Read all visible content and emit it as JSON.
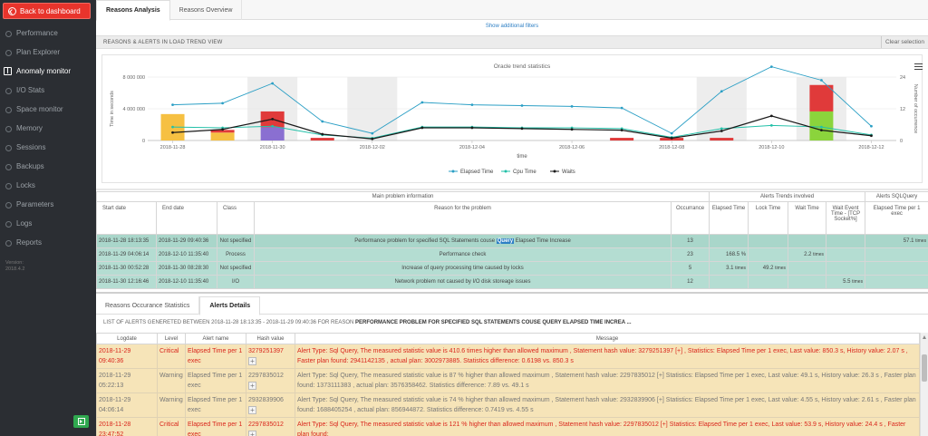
{
  "sidebar": {
    "back_label": "Back to dashboard",
    "items": [
      {
        "label": "Performance",
        "icon": "circle-icon",
        "active": false
      },
      {
        "label": "Plan Explorer",
        "icon": "circle-icon",
        "active": false
      },
      {
        "label": "Anomaly monitor",
        "icon": "book-icon",
        "active": true
      },
      {
        "label": "I/O Stats",
        "icon": "circle-icon",
        "active": false
      },
      {
        "label": "Space monitor",
        "icon": "circle-icon",
        "active": false
      },
      {
        "label": "Memory",
        "icon": "circle-icon",
        "active": false
      },
      {
        "label": "Sessions",
        "icon": "circle-icon",
        "active": false
      },
      {
        "label": "Backups",
        "icon": "circle-icon",
        "active": false
      },
      {
        "label": "Locks",
        "icon": "circle-icon",
        "active": false
      },
      {
        "label": "Parameters",
        "icon": "circle-icon",
        "active": false
      },
      {
        "label": "Logs",
        "icon": "circle-icon",
        "active": false
      },
      {
        "label": "Reports",
        "icon": "circle-icon",
        "active": false
      }
    ],
    "version_label": "Version:",
    "version_value": "2018.4.2"
  },
  "top_tabs": [
    {
      "label": "Reasons Analysis",
      "active": true
    },
    {
      "label": "Reasons Overview",
      "active": false
    }
  ],
  "additional_filters": "Show additional filters",
  "section": {
    "title": "REASONS & ALERTS IN LOAD TREND VIEW",
    "clear_label": "Clear selection"
  },
  "chart_data": {
    "type": "line",
    "title": "Oracle trend statistics",
    "xlabel": "time",
    "ylabel_left": "Time in seconds",
    "ylabel_right": "Number of occurrence",
    "y_ticks_left": [
      "0",
      "4 000 000",
      "8 000 000"
    ],
    "y_ticks_right": [
      "0",
      "12",
      "24"
    ],
    "ylim_left": [
      0,
      8000000
    ],
    "ylim_right": [
      0,
      24
    ],
    "x_ticks": [
      "2018-11-28",
      "2018-11-30",
      "2018-12-02",
      "2018-12-04",
      "2018-12-06",
      "2018-12-08",
      "2018-12-10",
      "2018-12-12"
    ],
    "x": [
      "2018-11-28",
      "2018-11-29",
      "2018-11-30",
      "2018-12-01",
      "2018-12-02",
      "2018-12-03",
      "2018-12-04",
      "2018-12-05",
      "2018-12-06",
      "2018-12-07",
      "2018-12-08",
      "2018-12-09",
      "2018-12-10",
      "2018-12-11",
      "2018-12-12"
    ],
    "series": [
      {
        "name": "Elapsed Time",
        "color": "#2b9fc5",
        "axis": "left",
        "values": [
          4500000,
          4700000,
          7200000,
          2400000,
          900000,
          4800000,
          4500000,
          4400000,
          4300000,
          4100000,
          900000,
          6200000,
          9300000,
          7600000,
          1800000
        ]
      },
      {
        "name": "Cpu Time",
        "color": "#22c0a8",
        "axis": "left",
        "values": [
          1700000,
          1600000,
          1800000,
          700000,
          300000,
          1700000,
          1700000,
          1600000,
          1600000,
          1500000,
          400000,
          1500000,
          1900000,
          1700000,
          700000
        ]
      },
      {
        "name": "Waits",
        "color": "#1a1a1a",
        "axis": "left",
        "values": [
          1000000,
          1400000,
          2700000,
          800000,
          200000,
          1600000,
          1600000,
          1500000,
          1400000,
          1300000,
          300000,
          1200000,
          3100000,
          1300000,
          600000
        ]
      }
    ],
    "stacked_bars": [
      {
        "x": "2018-11-28",
        "segments": [
          {
            "color": "#f6c042",
            "count": 10
          }
        ]
      },
      {
        "x": "2018-11-29",
        "segments": [
          {
            "color": "#f6c042",
            "count": 3
          },
          {
            "color": "#e03a3a",
            "count": 1
          }
        ]
      },
      {
        "x": "2018-11-30",
        "segments": [
          {
            "color": "#8a6fd1",
            "count": 5
          },
          {
            "color": "#e03a3a",
            "count": 6
          }
        ]
      },
      {
        "x": "2018-12-01",
        "segments": [
          {
            "color": "#e03a3a",
            "count": 1
          }
        ]
      },
      {
        "x": "2018-12-07",
        "segments": [
          {
            "color": "#e03a3a",
            "count": 1
          }
        ]
      },
      {
        "x": "2018-12-08",
        "segments": [
          {
            "color": "#e03a3a",
            "count": 1
          }
        ]
      },
      {
        "x": "2018-12-09",
        "segments": [
          {
            "color": "#e03a3a",
            "count": 1
          }
        ]
      },
      {
        "x": "2018-12-11",
        "segments": [
          {
            "color": "#8bd43c",
            "count": 11
          },
          {
            "color": "#e03a3a",
            "count": 10
          }
        ]
      }
    ],
    "highlight_ranges": [
      [
        "2018-11-30",
        "2018-12-01"
      ],
      [
        "2018-12-02",
        "2018-12-03"
      ],
      [
        "2018-12-09",
        "2018-12-10"
      ],
      [
        "2018-12-11",
        "2018-12-12"
      ]
    ],
    "legend_position": "bottom"
  },
  "reasons_table": {
    "group_headers": {
      "main": "Main problem information",
      "trends": "Alerts Trends involved",
      "sql": "Alerts SQLQuery"
    },
    "columns": [
      "Start date",
      "End date",
      "Class",
      "Reason for the problem",
      "Occurrance",
      "Elapsed Time",
      "Lock Time",
      "Wait Time",
      "Wait Event Time - [TCP Socket%]",
      "Elapsed Time per 1 exec"
    ],
    "rows": [
      {
        "start": "2018-11-28 18:13:35",
        "end": "2018-11-29 09:40:36",
        "class": "Not specified",
        "reason_pre": "Performance problem for specified SQL Statements couse",
        "reason_hl": "Query",
        "reason_post": "Elapsed Time Increase",
        "occ": "13",
        "elapsed": "",
        "lock": "",
        "wait": "",
        "waitev": "",
        "per1": "57.1",
        "per1_unit": "times"
      },
      {
        "start": "2018-11-29 04:06:14",
        "end": "2018-12-10 11:35:40",
        "class": "Process",
        "reason_pre": "Performance check",
        "reason_hl": "",
        "reason_post": "",
        "occ": "23",
        "elapsed": "168.5 %",
        "lock": "",
        "wait": "2.2",
        "wait_unit": "times",
        "waitev": "",
        "per1": ""
      },
      {
        "start": "2018-11-30 00:52:28",
        "end": "2018-11-30 08:28:30",
        "class": "Not specified",
        "reason_pre": "Increase of query processing time caused by locks",
        "reason_hl": "",
        "reason_post": "",
        "occ": "5",
        "elapsed": "3.1",
        "elapsed_unit": "times",
        "lock": "49.2",
        "lock_unit": "times",
        "wait": "",
        "waitev": "",
        "per1": ""
      },
      {
        "start": "2018-11-30 12:16:46",
        "end": "2018-12-10 11:35:40",
        "class": "I/O",
        "reason_pre": "Network problem not caused by I/O disk storeage issues",
        "reason_hl": "",
        "reason_post": "",
        "occ": "12",
        "elapsed": "",
        "lock": "",
        "wait": "",
        "waitev": "5.5",
        "waitev_unit": "times",
        "per1": ""
      }
    ]
  },
  "bottom_tabs": [
    {
      "label": "Reasons Occurance Statistics",
      "active": false
    },
    {
      "label": "Alerts Details",
      "active": true
    }
  ],
  "alerts_title_prefix": "LIST OF ALERTS GENERETED BETWEEN 2018-11-28 18:13:35 - 2018-11-29 09:40:36 FOR REASON",
  "alerts_title_reason": "PERFORMANCE PROBLEM FOR SPECIFIED SQL STATEMENTS COUSE QUERY ELAPSED TIME INCREA ...",
  "alerts_table": {
    "columns": [
      "Logdate",
      "Level",
      "Alert name",
      "Hash value",
      "Message"
    ],
    "rows": [
      {
        "date": "2018-11-29 09:40:36",
        "level": "Critical",
        "name": "Elapsed Time per 1 exec",
        "hash": "3279251397",
        "msg": "Alert Type: Sql Query, The measured statistic value is 410.6 times higher than allowed maximum , Statement hash value: 3279251397 [+] , Statistics: Elapsed Time per 1 exec, Last value: 850.3 s, History value: 2.07 s , Faster plan found: 2941142135 , actual plan: 3002973885. Statistics difference: 0.6198 vs. 850.3 s",
        "warn": false
      },
      {
        "date": "2018-11-29 05:22:13",
        "level": "Warning",
        "name": "Elapsed Time per 1 exec",
        "hash": "2297835012",
        "msg": "Alert Type: Sql Query, The measured statistic value is 87 % higher than allowed maximum , Statement hash value: 2297835012 [+] Statistics: Elapsed Time per 1 exec, Last value: 49.1 s, History value: 26.3 s , Faster plan found: 1373111383 , actual plan: 3576358462. Statistics difference: 7.89 vs. 49.1 s",
        "warn": true
      },
      {
        "date": "2018-11-29 04:06:14",
        "level": "Warning",
        "name": "Elapsed Time per 1 exec",
        "hash": "2932839906",
        "msg": "Alert Type: Sql Query, The measured statistic value is 74 % higher than allowed maximum , Statement hash value: 2932839906 [+] Statistics: Elapsed Time per 1 exec, Last value: 4.55 s, History value: 2.61 s , Faster plan found: 1688405254 , actual plan: 856944872. Statistics difference: 0.7419 vs. 4.55 s",
        "warn": true
      },
      {
        "date": "2018-11-28 23:47:52",
        "level": "Critical",
        "name": "Elapsed Time per 1 exec",
        "hash": "2297835012",
        "msg": "Alert Type: Sql Query, The measured statistic value is 121 % higher than allowed maximum , Statement hash value: 2297835012 [+] Statistics: Elapsed Time per 1 exec, Last value: 53.9 s, History value: 24.4 s , Faster plan found:",
        "warn": false
      }
    ]
  }
}
